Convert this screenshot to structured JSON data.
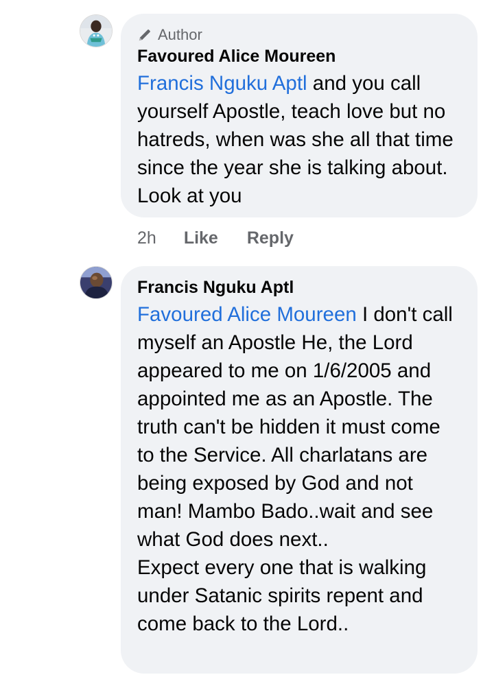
{
  "comments": [
    {
      "badge": "Author",
      "author": "Favoured Alice Moureen",
      "mention": "Francis Nguku Aptl",
      "text": " and you call yourself Apostle, teach love but no hatreds, when was she all that time since the year she is talking about. Look at you",
      "meta": {
        "time": "2h",
        "like": "Like",
        "reply": "Reply"
      }
    },
    {
      "author": "Francis Nguku Aptl",
      "mention": "Favoured Alice Moureen",
      "text": " I don't call myself an Apostle He, the Lord appeared to me on 1/6/2005 and appointed me as an Apostle. The truth can't be hidden it must come to the Service. All charlatans are being exposed by God and not man! Mambo Bado..wait and see what God does next..\nExpect every one that is walking under Satanic spirits repent and come back to the Lord.."
    }
  ],
  "icons": {
    "badge_icon": "pencil-icon"
  },
  "colors": {
    "bubble": "#f0f2f5",
    "mention": "#216fdb",
    "meta": "#65676b",
    "text": "#050505"
  }
}
